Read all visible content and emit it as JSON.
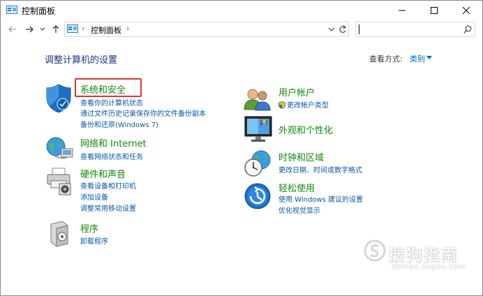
{
  "window": {
    "title": "控制面板"
  },
  "nav": {
    "back_icon": "arrow-left-icon",
    "forward_icon": "arrow-right-icon",
    "recent_icon": "chevron-down-icon",
    "up_icon": "arrow-up-icon"
  },
  "address": {
    "path": "控制面板",
    "separator": "›"
  },
  "search": {
    "placeholder": ""
  },
  "content": {
    "heading": "调整计算机的设置",
    "view_by_label": "查看方式:",
    "view_by_value": "类别"
  },
  "categories": {
    "system_security": {
      "title": "系统和安全",
      "links": [
        "查看你的计算机状态",
        "通过文件历史记录保存你的文件备份副本",
        "备份和还原(Windows 7)"
      ]
    },
    "network": {
      "title": "网络和 Internet",
      "links": [
        "查看网络状态和任务"
      ]
    },
    "hardware": {
      "title": "硬件和声音",
      "links": [
        "查看设备和打印机",
        "添加设备",
        "调整常用移动设置"
      ]
    },
    "programs": {
      "title": "程序",
      "links": [
        "卸载程序"
      ]
    },
    "user_accounts": {
      "title": "用户帐户",
      "links": [
        "更改帐户类型"
      ]
    },
    "appearance": {
      "title": "外观和个性化",
      "links": []
    },
    "clock_region": {
      "title": "时钟和区域",
      "links": [
        "更改日期、时间或数字格式"
      ]
    },
    "ease_of_access": {
      "title": "轻松使用",
      "links": [
        "使用 Windows 建议的设置",
        "优化视觉显示"
      ]
    }
  },
  "watermark": {
    "text": "搜狗指南",
    "sub": "zhinan.sogou.com"
  },
  "colors": {
    "category_title": "#118a0b",
    "link": "#0b57a6",
    "heading": "#1e3287",
    "highlight": "#e53232"
  }
}
